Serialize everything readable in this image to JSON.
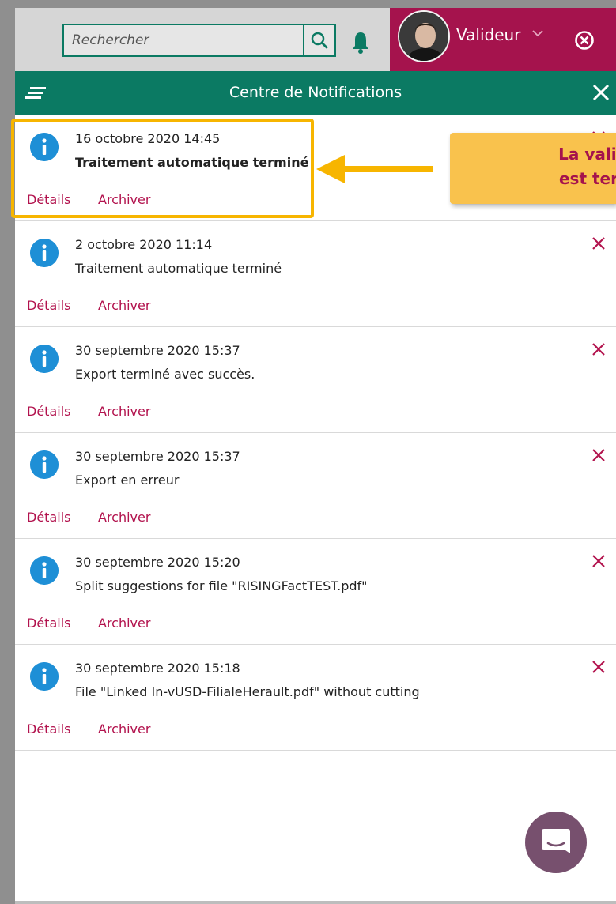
{
  "search": {
    "placeholder": "Rechercher"
  },
  "user": {
    "name": "Valideur"
  },
  "header": {
    "title": "Centre de Notifications"
  },
  "notifications": [
    {
      "date": "16 octobre 2020 14:45",
      "message": "Traitement automatique terminé",
      "details": "Détails",
      "archive": "Archiver"
    },
    {
      "date": "2 octobre 2020 11:14",
      "message": "Traitement automatique terminé",
      "details": "Détails",
      "archive": "Archiver"
    },
    {
      "date": "30 septembre 2020 15:37",
      "message": "Export terminé avec succès.",
      "details": "Détails",
      "archive": "Archiver"
    },
    {
      "date": "30 septembre 2020 15:37",
      "message": "Export en erreur",
      "details": "Détails",
      "archive": "Archiver"
    },
    {
      "date": "30 septembre 2020 15:20",
      "message": "Split suggestions for file \"RISINGFactTEST.pdf\"",
      "details": "Détails",
      "archive": "Archiver"
    },
    {
      "date": "30 septembre 2020 15:18",
      "message": "File \"Linked In-vUSD-FilialeHerault.pdf\" without cutting",
      "details": "Détails",
      "archive": "Archiver"
    }
  ],
  "callout": {
    "text": "La validation\nest terminée"
  },
  "colors": {
    "accent_green": "#0b7a63",
    "brand_magenta": "#a5134d",
    "info_blue": "#1e8fd6",
    "highlight": "#f7b500",
    "chat": "#77506e"
  }
}
